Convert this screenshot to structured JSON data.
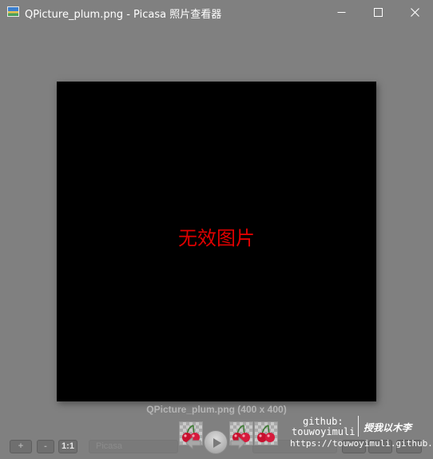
{
  "window": {
    "title": "QPicture_plum.png - Picasa 照片查看器",
    "icon": "picasa-photo-icon",
    "controls": [
      "minimize-icon",
      "maximize-icon",
      "close-icon"
    ]
  },
  "viewer": {
    "background_color": "#808080",
    "image_background": "#000000",
    "invalid_message": "无效图片",
    "invalid_color": "#e00000",
    "caption": "QPicture_plum.png (400 x 400)"
  },
  "toolbar": {
    "zoom_in_label": "+",
    "zoom_out_label": "-",
    "actual_size_label": "1:1",
    "picasa_label": "Picasa",
    "thumbnails": [
      "cherry-thumbnail",
      "cherry-thumbnail",
      "cherry-thumbnail"
    ],
    "nav_icons": [
      "arrow-left-icon",
      "play-icon",
      "arrow-right-icon"
    ]
  },
  "watermark": {
    "github_label": "github:",
    "username": "touwoyimuli",
    "motto": "授我以木李",
    "url": "https://touwoyimuli.github.io"
  }
}
